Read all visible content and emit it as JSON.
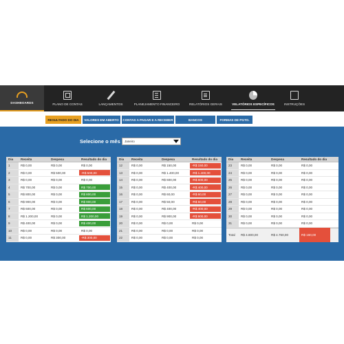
{
  "nav": {
    "dashboard": "DASHBOARDS",
    "items": [
      {
        "label": "PLANO DE CONTAS",
        "icon": "calculator-icon"
      },
      {
        "label": "LANÇAMENTOS",
        "icon": "pen-icon"
      },
      {
        "label": "PLANEJAMENTO FINANCEIRO",
        "icon": "list-icon"
      },
      {
        "label": "RELATÓRIOS GERAIS",
        "icon": "document-icon"
      },
      {
        "label": "VELATÓRIOS ESPECÍFICOS",
        "icon": "pie-chart-icon",
        "active": true
      },
      {
        "label": "INSTRUÇÕES",
        "icon": "instructions-icon"
      }
    ]
  },
  "subtabs": [
    "RESULTADO DO DIA",
    "VALORES EM ABERTO",
    "CONTAS A PAGAR E A RECEBER",
    "BANCOS",
    "FORMAS DE PGTO."
  ],
  "month": {
    "label": "Selecione o mês",
    "value": "Janeiro"
  },
  "table": {
    "headers": [
      "Dia",
      "Receita",
      "Despesa",
      "Resultado do dia"
    ],
    "total_label": "Total",
    "total_receita": "R$ 4.800,00",
    "total_despesa": "R$ 4.760,00",
    "total_resultado": "R$ 160,00",
    "col1": [
      {
        "dia": "1",
        "receita": "R$ 0,00",
        "despesa": "R$ 0,00",
        "resultado": "R$ 0,00",
        "status": "plain"
      },
      {
        "dia": "2",
        "receita": "R$ 0,00",
        "despesa": "R$ 500,00",
        "resultado": "-R$ 500,00",
        "status": "red"
      },
      {
        "dia": "3",
        "receita": "R$ 0,00",
        "despesa": "R$ 0,00",
        "resultado": "R$ 0,00",
        "status": "plain"
      },
      {
        "dia": "4",
        "receita": "R$ 700,00",
        "despesa": "R$ 0,00",
        "resultado": "R$ 700,00",
        "status": "green"
      },
      {
        "dia": "5",
        "receita": "R$ 800,00",
        "despesa": "R$ 0,00",
        "resultado": "R$ 800,00",
        "status": "green"
      },
      {
        "dia": "6",
        "receita": "R$ 900,00",
        "despesa": "R$ 0,00",
        "resultado": "R$ 900,00",
        "status": "green"
      },
      {
        "dia": "7",
        "receita": "R$ 600,00",
        "despesa": "R$ 0,00",
        "resultado": "R$ 600,00",
        "status": "green"
      },
      {
        "dia": "8",
        "receita": "R$ 1.200,00",
        "despesa": "R$ 0,00",
        "resultado": "R$ 1.200,00",
        "status": "green"
      },
      {
        "dia": "9",
        "receita": "R$ 400,00",
        "despesa": "R$ 0,00",
        "resultado": "R$ 400,00",
        "status": "green"
      },
      {
        "dia": "10",
        "receita": "R$ 0,00",
        "despesa": "R$ 0,00",
        "resultado": "R$ 0,00",
        "status": "plain"
      },
      {
        "dia": "11",
        "receita": "R$ 0,00",
        "despesa": "R$ 300,00",
        "resultado": "-R$ 300,00",
        "status": "red"
      }
    ],
    "col2": [
      {
        "dia": "12",
        "receita": "R$ 0,00",
        "despesa": "R$ 150,00",
        "resultado": "-R$ 150,00",
        "status": "red"
      },
      {
        "dia": "13",
        "receita": "R$ 0,00",
        "despesa": "R$ 1.400,00",
        "resultado": "-R$ 1.400,00",
        "status": "red"
      },
      {
        "dia": "14",
        "receita": "R$ 0,00",
        "despesa": "R$ 600,00",
        "resultado": "-R$ 600,00",
        "status": "red"
      },
      {
        "dia": "15",
        "receita": "R$ 0,00",
        "despesa": "R$ 400,00",
        "resultado": "-R$ 400,00",
        "status": "red"
      },
      {
        "dia": "16",
        "receita": "R$ 0,00",
        "despesa": "R$ 60,00",
        "resultado": "-R$ 60,00",
        "status": "red"
      },
      {
        "dia": "17",
        "receita": "R$ 0,00",
        "despesa": "R$ 50,00",
        "resultado": "-R$ 50,00",
        "status": "red"
      },
      {
        "dia": "18",
        "receita": "R$ 0,00",
        "despesa": "R$ 400,00",
        "resultado": "-R$ 400,00",
        "status": "red"
      },
      {
        "dia": "19",
        "receita": "R$ 0,00",
        "despesa": "R$ 900,00",
        "resultado": "-R$ 900,00",
        "status": "red"
      },
      {
        "dia": "20",
        "receita": "R$ 0,00",
        "despesa": "R$ 0,00",
        "resultado": "R$ 0,00",
        "status": "plain"
      },
      {
        "dia": "21",
        "receita": "R$ 0,00",
        "despesa": "R$ 0,00",
        "resultado": "R$ 0,00",
        "status": "plain"
      },
      {
        "dia": "22",
        "receita": "R$ 0,00",
        "despesa": "R$ 0,00",
        "resultado": "R$ 0,00",
        "status": "plain"
      }
    ],
    "col3": [
      {
        "dia": "23",
        "receita": "R$ 0,00",
        "despesa": "R$ 0,00",
        "resultado": "R$ 0,00",
        "status": "plain"
      },
      {
        "dia": "24",
        "receita": "R$ 0,00",
        "despesa": "R$ 0,00",
        "resultado": "R$ 0,00",
        "status": "plain"
      },
      {
        "dia": "25",
        "receita": "R$ 0,00",
        "despesa": "R$ 0,00",
        "resultado": "R$ 0,00",
        "status": "plain"
      },
      {
        "dia": "26",
        "receita": "R$ 0,00",
        "despesa": "R$ 0,00",
        "resultado": "R$ 0,00",
        "status": "plain"
      },
      {
        "dia": "27",
        "receita": "R$ 0,00",
        "despesa": "R$ 0,00",
        "resultado": "R$ 0,00",
        "status": "plain"
      },
      {
        "dia": "28",
        "receita": "R$ 0,00",
        "despesa": "R$ 0,00",
        "resultado": "R$ 0,00",
        "status": "plain"
      },
      {
        "dia": "29",
        "receita": "R$ 0,00",
        "despesa": "R$ 0,00",
        "resultado": "R$ 0,00",
        "status": "plain"
      },
      {
        "dia": "30",
        "receita": "R$ 0,00",
        "despesa": "R$ 0,00",
        "resultado": "R$ 0,00",
        "status": "plain"
      },
      {
        "dia": "31",
        "receita": "R$ 0,00",
        "despesa": "R$ 0,00",
        "resultado": "R$ 0,00",
        "status": "plain"
      }
    ]
  },
  "colors": {
    "nav_bg": "#232323",
    "accent": "#e8a021",
    "app_bg": "#2a6aa7",
    "negative": "#e4503b",
    "positive": "#3a9e3a"
  }
}
